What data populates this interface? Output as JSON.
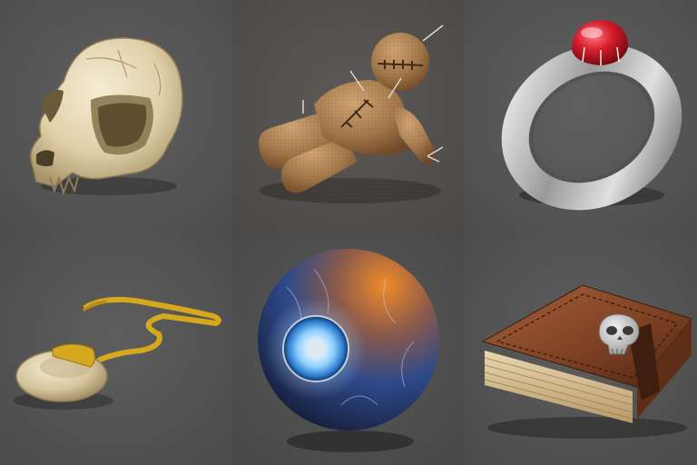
{
  "inventory": {
    "columns": 3,
    "rows": 2,
    "items": [
      {
        "icon": "skull-icon"
      },
      {
        "icon": "voodoo-doll-icon"
      },
      {
        "icon": "ruby-ring-icon"
      },
      {
        "icon": "bone-amulet-icon"
      },
      {
        "icon": "magic-eye-orb-icon"
      },
      {
        "icon": "skull-spellbook-icon"
      }
    ]
  },
  "colors": {
    "bone": "#e6d9b8",
    "burlap": "#a3784a",
    "silver": "#c8c8c8",
    "ruby": "#d41e2a",
    "gold": "#d6a81e",
    "orb_blue": "#2e4a8a",
    "iris_glow": "#8fd0ff",
    "leather": "#7a3f22"
  }
}
